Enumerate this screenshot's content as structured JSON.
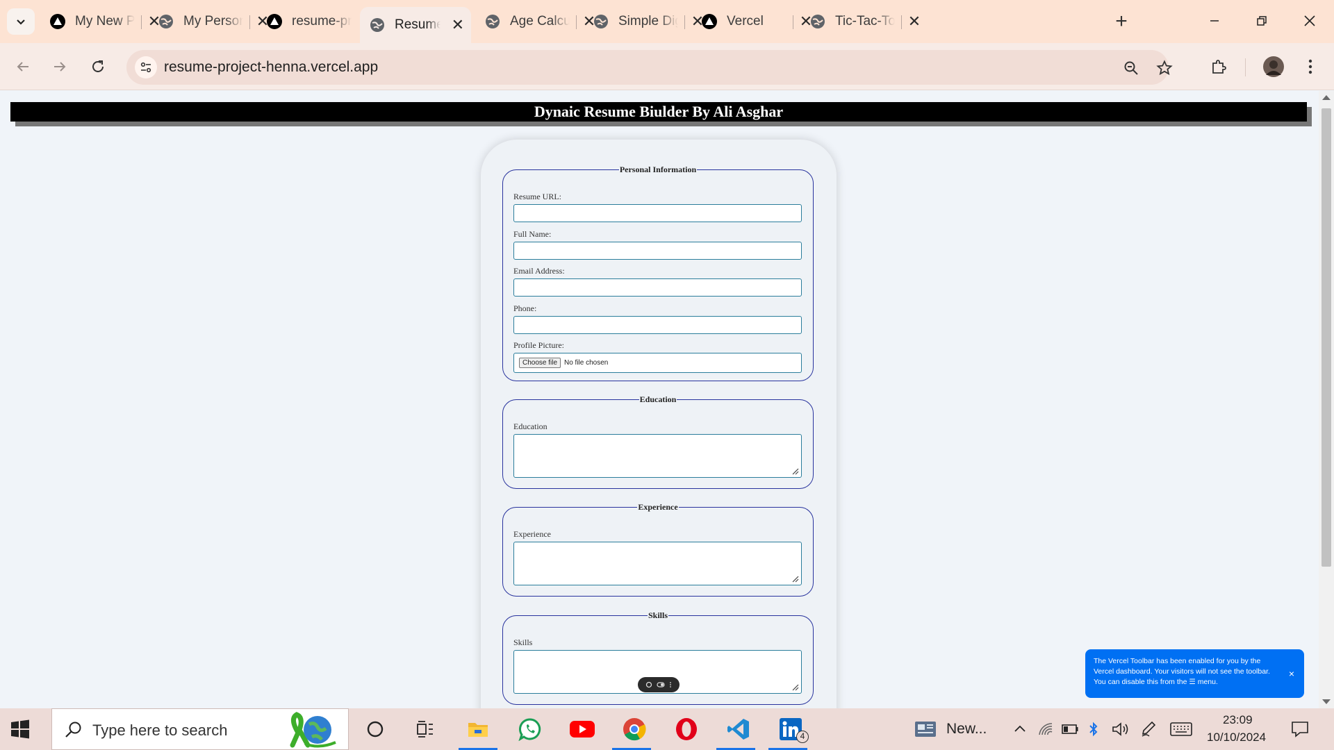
{
  "browser": {
    "tabs": [
      {
        "title": "My New Portfolio",
        "icon": "vercel-triangle-icon",
        "active": false
      },
      {
        "title": "My Personal Portfolio",
        "icon": "globe-icon",
        "active": false
      },
      {
        "title": "resume-project",
        "icon": "vercel-triangle-icon",
        "active": false
      },
      {
        "title": "Resume Builder",
        "icon": "globe-icon",
        "active": true
      },
      {
        "title": "Age Calculator",
        "icon": "globe-icon",
        "active": false
      },
      {
        "title": "Simple Digital Clock",
        "icon": "globe-icon",
        "active": false
      },
      {
        "title": "Vercel",
        "icon": "vercel-triangle-icon",
        "active": false
      },
      {
        "title": "Tic-Tac-Toe",
        "icon": "globe-icon",
        "active": false
      }
    ],
    "url": "resume-project-henna.vercel.app"
  },
  "page": {
    "header_title": "Dynaic Resume Biulder By Ali Asghar",
    "sections": {
      "personal": {
        "legend": "Personal Information",
        "resume_url_label": "Resume URL:",
        "full_name_label": "Full Name:",
        "email_label": "Email Address:",
        "phone_label": "Phone:",
        "profile_picture_label": "Profile Picture:",
        "choose_file_label": "Choose file",
        "no_file_text": "No file chosen"
      },
      "education": {
        "legend": "Education",
        "label": "Education"
      },
      "experience": {
        "legend": "Experience",
        "label": "Experience"
      },
      "skills": {
        "legend": "Skills",
        "label": "Skills"
      }
    }
  },
  "vercel_toast": {
    "message": "The Vercel Toolbar has been enabled for you by the Vercel dashboard. Your visitors will not see the toolbar. You can disable this from the ☰ menu.",
    "close": "×"
  },
  "taskbar": {
    "search_placeholder": "Type here to search",
    "news_label": "New...",
    "linkedin_badge": "4",
    "time": "23:09",
    "date": "10/10/2024"
  },
  "colors": {
    "tabbar_bg": "#fde3d3",
    "fieldset_border": "#27329d",
    "input_border": "#2a7d9b",
    "toast_bg": "#0070f3"
  }
}
